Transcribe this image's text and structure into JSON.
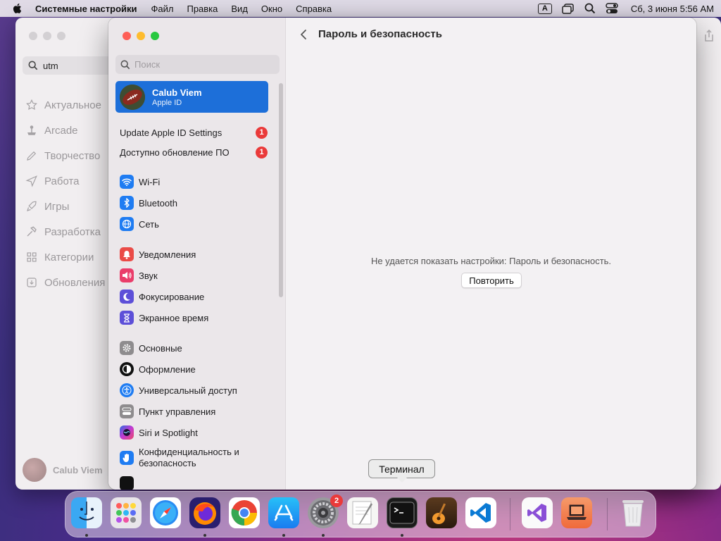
{
  "menubar": {
    "app_name": "Системные настройки",
    "items": [
      "Файл",
      "Правка",
      "Вид",
      "Окно",
      "Справка"
    ],
    "input_badge": "A",
    "clock": "Сб, 3 июня  5:56 AM"
  },
  "back_window": {
    "search_value": "utm",
    "nav": [
      "Актуальное",
      "Arcade",
      "Творчество",
      "Работа",
      "Игры",
      "Разработка",
      "Категории",
      "Обновления"
    ],
    "user_name": "Calub Viem"
  },
  "sidebar": {
    "search_placeholder": "Поиск",
    "apple_id": {
      "name": "Calub Viem",
      "sub": "Apple ID"
    },
    "notices": [
      {
        "label": "Update Apple ID Settings",
        "badge": "1"
      },
      {
        "label": "Доступно обновление ПО",
        "badge": "1"
      }
    ],
    "groups": [
      [
        {
          "label": "Wi-Fi",
          "icon": "wifi-icon",
          "color": "#1f7cf2"
        },
        {
          "label": "Bluetooth",
          "icon": "bluetooth-icon",
          "color": "#1f7cf2"
        },
        {
          "label": "Сеть",
          "icon": "globe-icon",
          "color": "#1f7cf2"
        }
      ],
      [
        {
          "label": "Уведомления",
          "icon": "bell-icon",
          "color": "#ea4b47"
        },
        {
          "label": "Звук",
          "icon": "speaker-icon",
          "color": "#ea3d6a"
        },
        {
          "label": "Фокусирование",
          "icon": "moon-icon",
          "color": "#5d4fd8"
        },
        {
          "label": "Экранное время",
          "icon": "hourglass-icon",
          "color": "#5d4fd8"
        }
      ],
      [
        {
          "label": "Основные",
          "icon": "gear-icon",
          "color": "#8e8c8e"
        },
        {
          "label": "Оформление",
          "icon": "appearance-icon",
          "color": "#111111"
        },
        {
          "label": "Универсальный доступ",
          "icon": "accessibility-icon",
          "color": "#1f7cf2"
        },
        {
          "label": "Пункт управления",
          "icon": "control-center-icon",
          "color": "#8e8c8e"
        },
        {
          "label": "Siri и Spotlight",
          "icon": "siri-icon",
          "color": "#b53cd6"
        },
        {
          "label": "Конфиденциальность и безопасность",
          "icon": "hand-icon",
          "color": "#1f7cf2"
        }
      ]
    ]
  },
  "content": {
    "title": "Пароль и безопасность",
    "error": "Не удается показать настройки: Пароль и безопасность.",
    "retry_label": "Повторить"
  },
  "tooltip": "Терминал",
  "dock": {
    "settings_badge": "2",
    "apps": [
      "finder",
      "launchpad",
      "safari",
      "firefox",
      "chrome",
      "app-store",
      "system-settings",
      "textedit",
      "terminal",
      "garageband",
      "vscode",
      "visual-studio",
      "utm",
      "trash"
    ]
  }
}
